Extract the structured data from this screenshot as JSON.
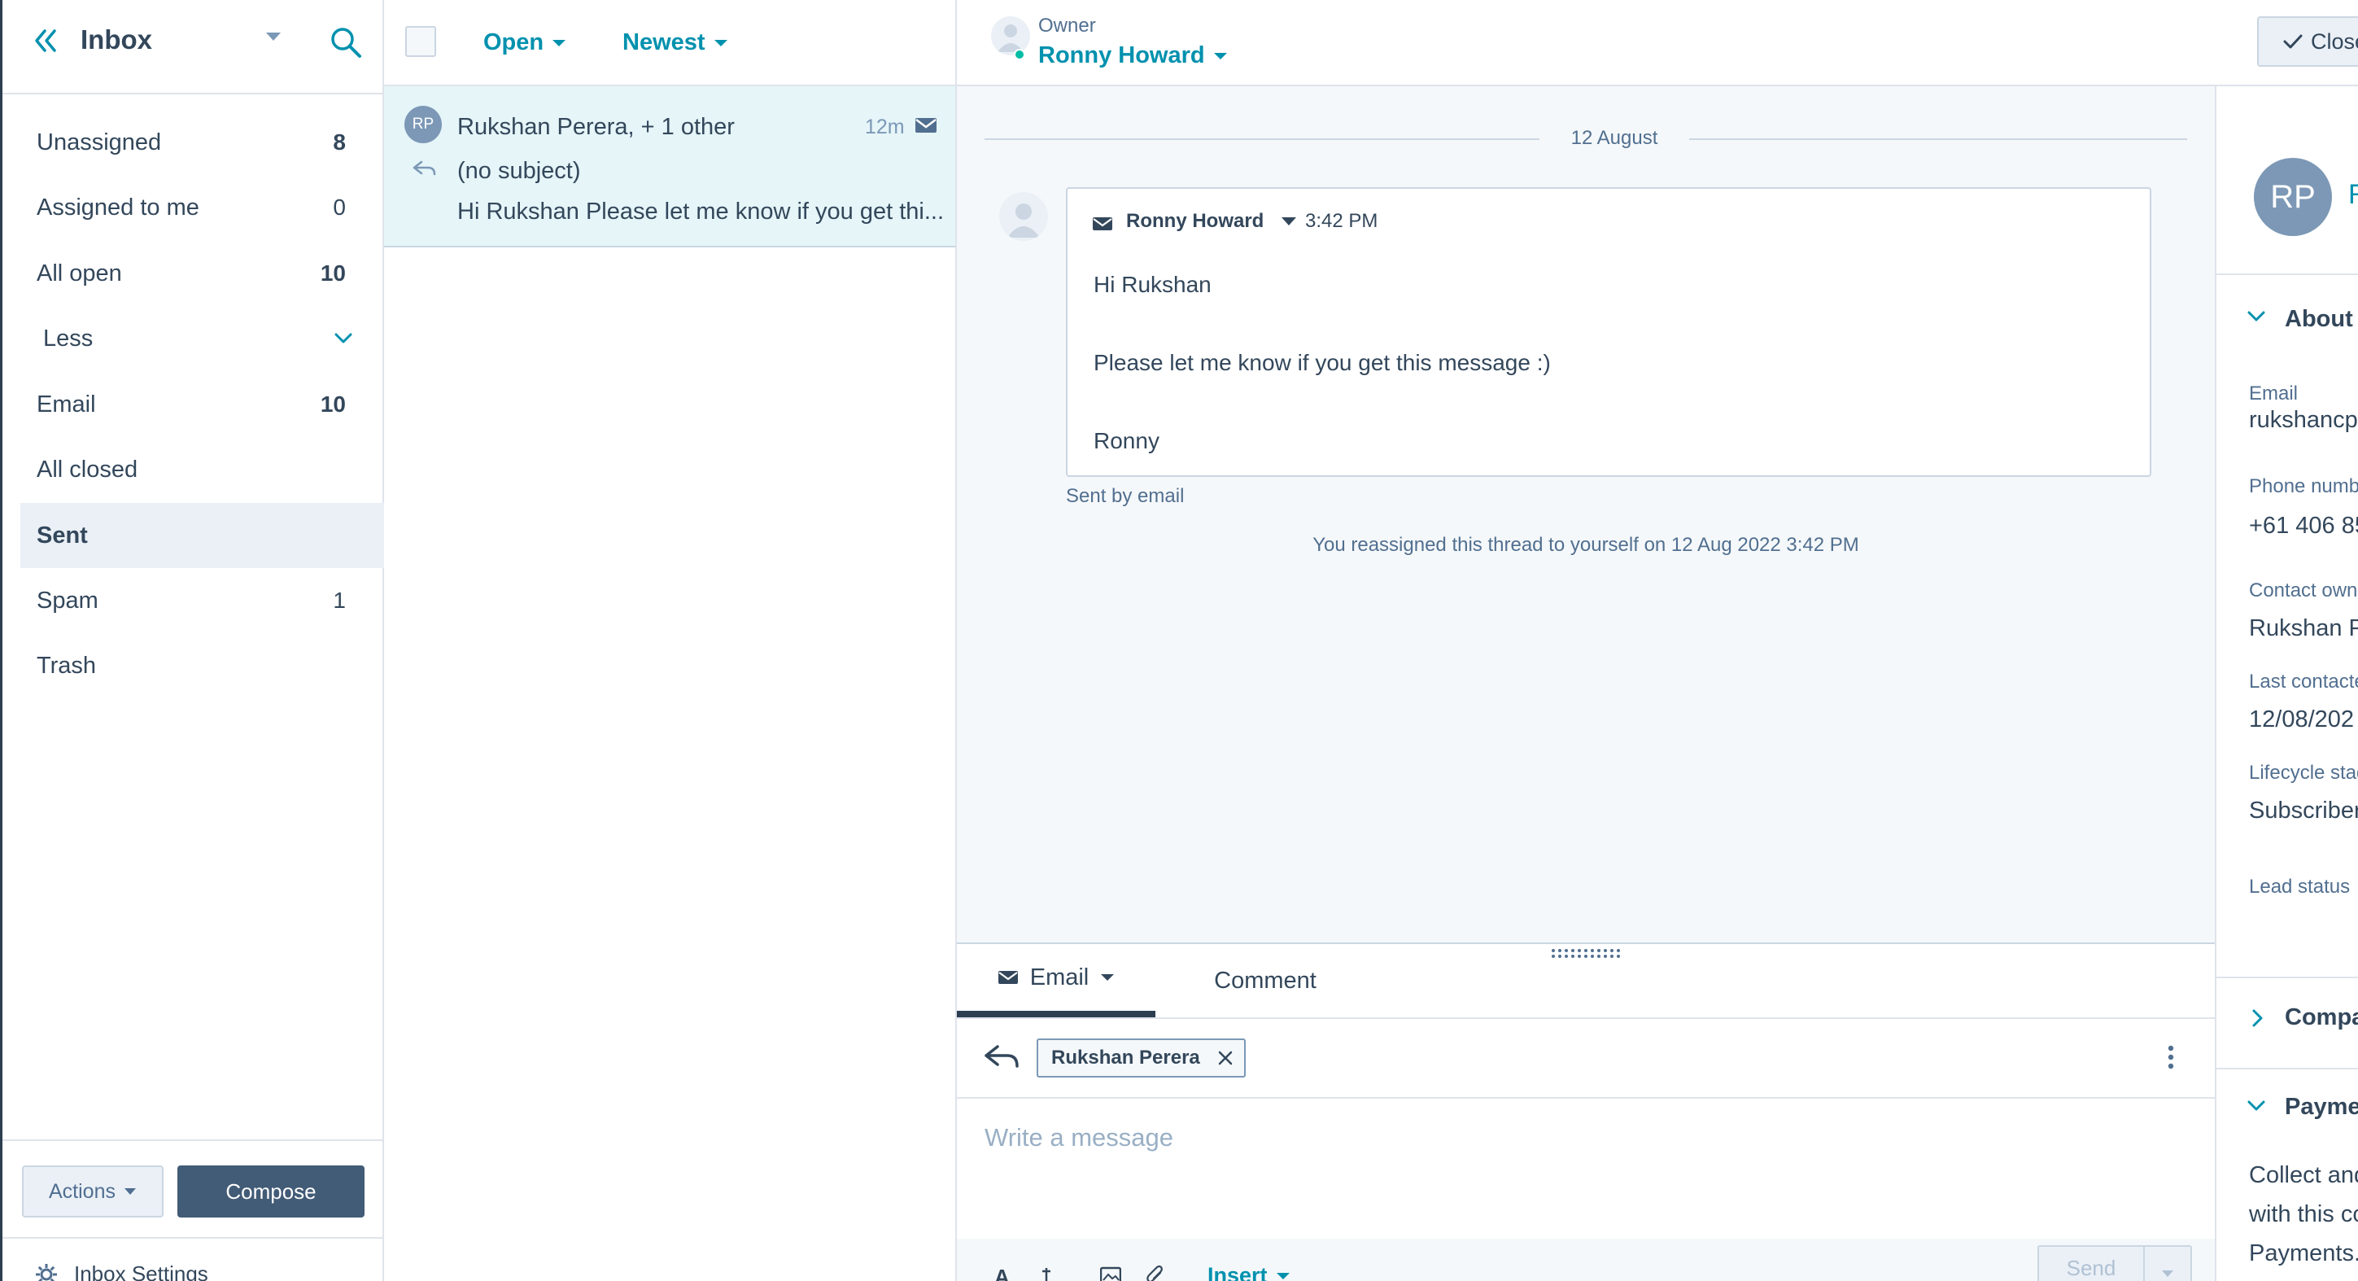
{
  "sidebar": {
    "title": "Inbox",
    "items": [
      {
        "label": "Unassigned",
        "count": "8"
      },
      {
        "label": "Assigned to me",
        "count": "0"
      },
      {
        "label": "All open",
        "count": "10"
      },
      {
        "label": "Less",
        "count": ""
      },
      {
        "label": "Email",
        "count": "10"
      },
      {
        "label": "All closed",
        "count": ""
      },
      {
        "label": "Sent",
        "count": ""
      },
      {
        "label": "Spam",
        "count": "1"
      },
      {
        "label": "Trash",
        "count": ""
      }
    ],
    "actions_label": "Actions",
    "compose_label": "Compose",
    "settings_label": "Inbox Settings"
  },
  "threadlist": {
    "filter_status": "Open",
    "sort": "Newest",
    "thread": {
      "avatar_initials": "RP",
      "sender": "Rukshan Perera, + 1 other",
      "time": "12m",
      "subject": "(no subject)",
      "preview": "Hi Rukshan Please let me know if you get thi..."
    }
  },
  "conversation": {
    "owner_label": "Owner",
    "owner_name": "Ronny Howard",
    "close_label": "Close",
    "date_divider": "12 August",
    "message": {
      "sender": "Ronny Howard",
      "time": "3:42 PM",
      "greeting": "Hi Rukshan",
      "body": "Please let me know if you get this message :)",
      "signoff": "Ronny",
      "sent_by": "Sent by email"
    },
    "system_note": "You reassigned this thread to yourself on 12 Aug 2022 3:42 PM"
  },
  "composer": {
    "tab_email": "Email",
    "tab_comment": "Comment",
    "recipient": "Rukshan Perera",
    "placeholder": "Write a message",
    "insert_label": "Insert",
    "send_label": "Send"
  },
  "contact": {
    "avatar_initials": "RP",
    "name_partial": "R",
    "about_title": "About",
    "email_label": "Email",
    "email_value": "rukshancp",
    "phone_label": "Phone numb",
    "phone_value": "+61 406 85",
    "owner_label": "Contact own",
    "owner_value": "Rukshan Pe",
    "last_contacted_label": "Last contacte",
    "last_contacted_value": "12/08/202",
    "lifecycle_label": "Lifecycle stag",
    "lifecycle_value": "Subscriber",
    "lead_status_label": "Lead status",
    "companies_title": "Compa",
    "payments_title": "Payme",
    "payments_text_1": "Collect and",
    "payments_text_2": "with this co",
    "payments_text_3": "Payments."
  },
  "colors": {
    "teal": "#0091ae",
    "dark_slate": "#33475b",
    "selected_row": "#e5f5f8",
    "compose_button": "#425b76",
    "online_dot": "#00bda5"
  }
}
